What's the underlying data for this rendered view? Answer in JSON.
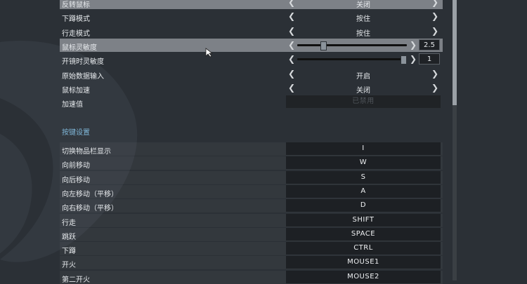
{
  "settings": [
    {
      "label": "反转鼠标",
      "type": "select",
      "value": "关闭",
      "highlight": true
    },
    {
      "label": "下蹲模式",
      "type": "select",
      "value": "按住"
    },
    {
      "label": "行走模式",
      "type": "select",
      "value": "按住"
    },
    {
      "label": "鼠标灵敏度",
      "type": "slider",
      "value": "2.5",
      "level": 0.22,
      "highlight": true
    },
    {
      "label": "开镜时灵敏度",
      "type": "slider",
      "value": "1",
      "level": 0.98
    },
    {
      "label": "原始数据输入",
      "type": "select",
      "value": "开启"
    },
    {
      "label": "鼠标加速",
      "type": "select",
      "value": "关闭"
    },
    {
      "label": "加速值",
      "type": "disabled",
      "value": "已禁用"
    }
  ],
  "section_title": "按键设置",
  "keybinds": [
    {
      "label": "切换物品栏显示",
      "key": "I"
    },
    {
      "label": "向前移动",
      "key": "W"
    },
    {
      "label": "向后移动",
      "key": "S"
    },
    {
      "label": "向左移动（平移）",
      "key": "A"
    },
    {
      "label": "向右移动（平移）",
      "key": "D"
    },
    {
      "label": "行走",
      "key": "SHIFT"
    },
    {
      "label": "跳跃",
      "key": "SPACE"
    },
    {
      "label": "下蹲",
      "key": "CTRL"
    },
    {
      "label": "开火",
      "key": "MOUSE1"
    },
    {
      "label": "第二开火",
      "key": "MOUSE2"
    }
  ],
  "icons": {
    "left": "chevron-left-icon",
    "right": "chevron-right-icon",
    "cursor": "mouse-cursor-icon"
  },
  "colors": {
    "background": "#2b3036",
    "highlight_row": "#7d8187",
    "section_title": "#7fb6d8",
    "keybox": "#1d2024"
  }
}
